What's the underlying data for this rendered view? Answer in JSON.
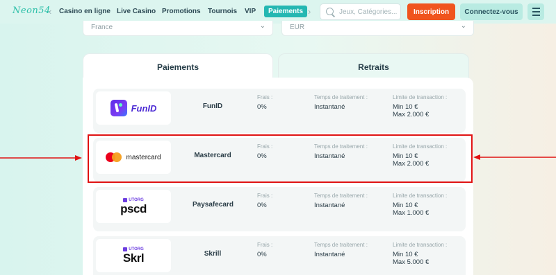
{
  "header": {
    "logo_text": "Neon54",
    "nav_items": [
      "Casino en ligne",
      "Live Casino",
      "Promotions",
      "Tournois",
      "VIP",
      "Paiements"
    ],
    "search_placeholder": "Jeux, Catégories...",
    "signup_label": "Inscription",
    "login_label": "Connectez-vous",
    "menu_icon": "hamburger-icon"
  },
  "filters": {
    "country": "France",
    "currency": "EUR"
  },
  "tabs": {
    "deposits": "Paiements",
    "withdrawals": "Retraits"
  },
  "columns": {
    "fee_label": "Frais :",
    "time_label": "Temps de traitement :",
    "limit_label": "Limite de transaction :"
  },
  "methods": [
    {
      "name": "FunID",
      "logo_text": "FunID",
      "fee": "0%",
      "time": "Instantané",
      "min": "Min 10 €",
      "max": "Max 2.000 €"
    },
    {
      "name": "Mastercard",
      "logo_text": "mastercard",
      "fee": "0%",
      "time": "Instantané",
      "min": "Min 10 €",
      "max": "Max 2.000 €"
    },
    {
      "name": "Paysafecard",
      "logo_text": "pscd",
      "logo_sub": "UTORG",
      "fee": "0%",
      "time": "Instantané",
      "min": "Min 10 €",
      "max": "Max 1.000 €"
    },
    {
      "name": "Skrill",
      "logo_text": "Skrl",
      "logo_sub": "UTORG",
      "fee": "0%",
      "time": "Instantané",
      "min": "Min 10 €",
      "max": "Max 5.000 €"
    }
  ],
  "colors": {
    "accent": "#24b7b2",
    "signup": "#f0541e",
    "highlight": "#e01212"
  }
}
